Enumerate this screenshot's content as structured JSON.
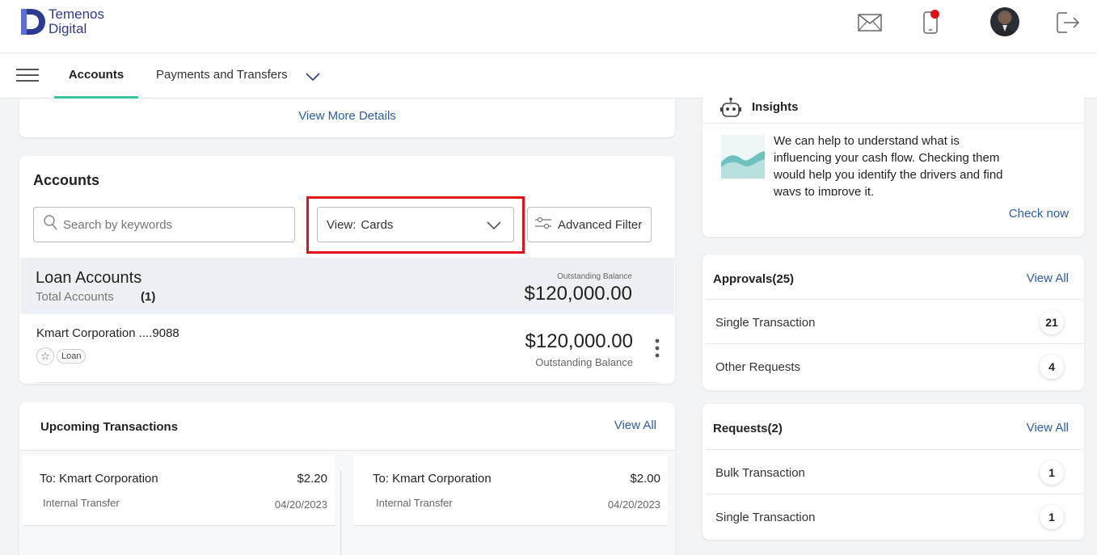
{
  "header": {
    "logo_line1": "Temenos",
    "logo_line2": "Digital",
    "icons": [
      "mail-icon",
      "mobile-notification-icon",
      "avatar",
      "logout-icon"
    ]
  },
  "nav": {
    "tabs": [
      {
        "label": "Accounts",
        "active": true
      },
      {
        "label": "Payments and Transfers",
        "active": false
      }
    ]
  },
  "details_card": {
    "link": "View More Details"
  },
  "accounts": {
    "title": "Accounts",
    "search_placeholder": "Search by keywords",
    "view_label": "View:",
    "view_value": "Cards",
    "advanced_filter": "Advanced Filter",
    "loan_group": {
      "title": "Loan Accounts",
      "total_label": "Total Accounts",
      "total_count": "(1)",
      "balance_caption": "Outstanding Balance",
      "balance": "$120,000.00"
    },
    "account": {
      "name": "Kmart Corporation ....9088",
      "type_badge": "Loan",
      "balance": "$120,000.00",
      "balance_caption": "Outstanding Balance"
    }
  },
  "upcoming": {
    "title": "Upcoming Transactions",
    "view_all": "View All",
    "items": [
      {
        "to": "To: Kmart Corporation",
        "amount": "$2.20",
        "type": "Internal Transfer",
        "date": "04/20/2023"
      },
      {
        "to": "To: Kmart Corporation",
        "amount": "$2.00",
        "type": "Internal Transfer",
        "date": "04/20/2023"
      }
    ]
  },
  "insights": {
    "title": "Insights",
    "text": "We can help to understand what is influencing your cash flow. Checking them would help you identify the drivers and find ways to improve it.",
    "link": "Check now"
  },
  "approvals": {
    "title": "Approvals(25)",
    "view_all": "View All",
    "rows": [
      {
        "label": "Single Transaction",
        "count": "21"
      },
      {
        "label": "Other Requests",
        "count": "4"
      }
    ]
  },
  "requests": {
    "title": "Requests(2)",
    "view_all": "View All",
    "rows": [
      {
        "label": "Bulk Transaction",
        "count": "1"
      },
      {
        "label": "Single Transaction",
        "count": "1"
      }
    ]
  },
  "colors": {
    "accent": "#3cc5a3",
    "link": "#2b5ea7",
    "highlight": "#e0111b",
    "brand": "#2c3a8f"
  }
}
